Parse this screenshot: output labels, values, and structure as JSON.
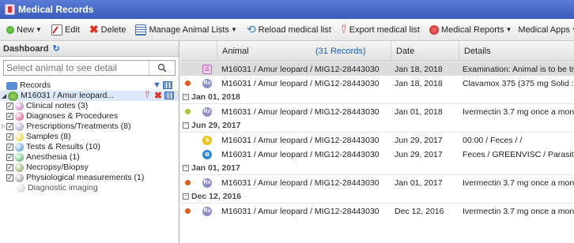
{
  "window": {
    "title": "Medical Records"
  },
  "toolbar": {
    "new_label": "New",
    "edit_label": "Edit",
    "delete_label": "Delete",
    "manage_lists_label": "Manage Animal Lists",
    "reload_label": "Reload medical list",
    "export_label": "Export medical list",
    "reports_label": "Medical Reports",
    "apps_label": "Medical Apps"
  },
  "dashboard": {
    "title": "Dashboard",
    "search_placeholder": "Select animal to see detail",
    "records_label": "Records",
    "patient_label": "M16031 / Amur leopard...",
    "categories": [
      {
        "label": "Clinical notes (3)",
        "icon": "clinical-notes-icon",
        "color": "#c35bb5"
      },
      {
        "label": "Diagnoses & Procedures",
        "icon": "diagnoses-icon",
        "color": "#d23a7a"
      },
      {
        "label": "Prescriptions/Treatments (8)",
        "icon": "rx-icon",
        "color": "#8e8ec8"
      },
      {
        "label": "Samples (8)",
        "icon": "samples-icon",
        "color": "#f2c20e"
      },
      {
        "label": "Tests & Results (10)",
        "icon": "tests-icon",
        "color": "#2d8ad1"
      },
      {
        "label": "Anesthesia (1)",
        "icon": "anesthesia-icon",
        "color": "#2fb34a"
      },
      {
        "label": "Necropsy/Biopsy",
        "icon": "necropsy-icon",
        "color": "#6f9a2e"
      },
      {
        "label": "Physiological measurements (1)",
        "icon": "physio-icon",
        "color": "#8a8a8a"
      },
      {
        "label": "Diagnostic imaging",
        "icon": "imaging-icon",
        "color": "#c8c8c8"
      }
    ]
  },
  "grid": {
    "col_animal": "Animal",
    "records_count": "(31 Records)",
    "col_date": "Date",
    "col_details": "Details",
    "rows": [
      {
        "type": "row",
        "status": "",
        "icon": "note",
        "animal": "M16031 / Amur leopard / MIG12-28443030",
        "date": "Jan 18, 2018",
        "details": "Examination: Animal is to be tr",
        "selected": true
      },
      {
        "type": "row",
        "status": "#e25a1c",
        "icon": "rx",
        "animal": "M16031 / Amur leopard / MIG12-28443030",
        "date": "Jan 18, 2018",
        "details": "Clavamox 375 (375 mg Solid :"
      },
      {
        "type": "group",
        "label": "Jan 01, 2018"
      },
      {
        "type": "row",
        "status": "#a6c832",
        "icon": "rx",
        "animal": "M16031 / Amur leopard / MIG12-28443030",
        "date": "Jan 01, 2018",
        "details": "Ivermectin 3.7 mg once a mon"
      },
      {
        "type": "group",
        "label": "Jun 29, 2017"
      },
      {
        "type": "row",
        "status": "",
        "icon": "sample",
        "animal": "M16031 / Amur leopard / MIG12-28443030",
        "date": "Jun 29, 2017",
        "details": "00:00 / Feces / /"
      },
      {
        "type": "row",
        "status": "",
        "icon": "test",
        "animal": "M16031 / Amur leopard / MIG12-28443030",
        "date": "Jun 29, 2017",
        "details": "Feces / GREENVISC / Parasit"
      },
      {
        "type": "group",
        "label": "Jan 01, 2017"
      },
      {
        "type": "row",
        "status": "#e25a1c",
        "icon": "rx",
        "animal": "M16031 / Amur leopard / MIG12-28443030",
        "date": "Jan 01, 2017",
        "details": "Ivermectin 3.7 mg once a mon"
      },
      {
        "type": "group",
        "label": "Dec 12, 2016"
      },
      {
        "type": "row",
        "status": "#e25a1c",
        "icon": "rx",
        "animal": "M16031 / Amur leopard / MIG12-28443030",
        "date": "Dec 12, 2016",
        "details": "Ivermectin 3.7 mg once a mon"
      }
    ]
  }
}
